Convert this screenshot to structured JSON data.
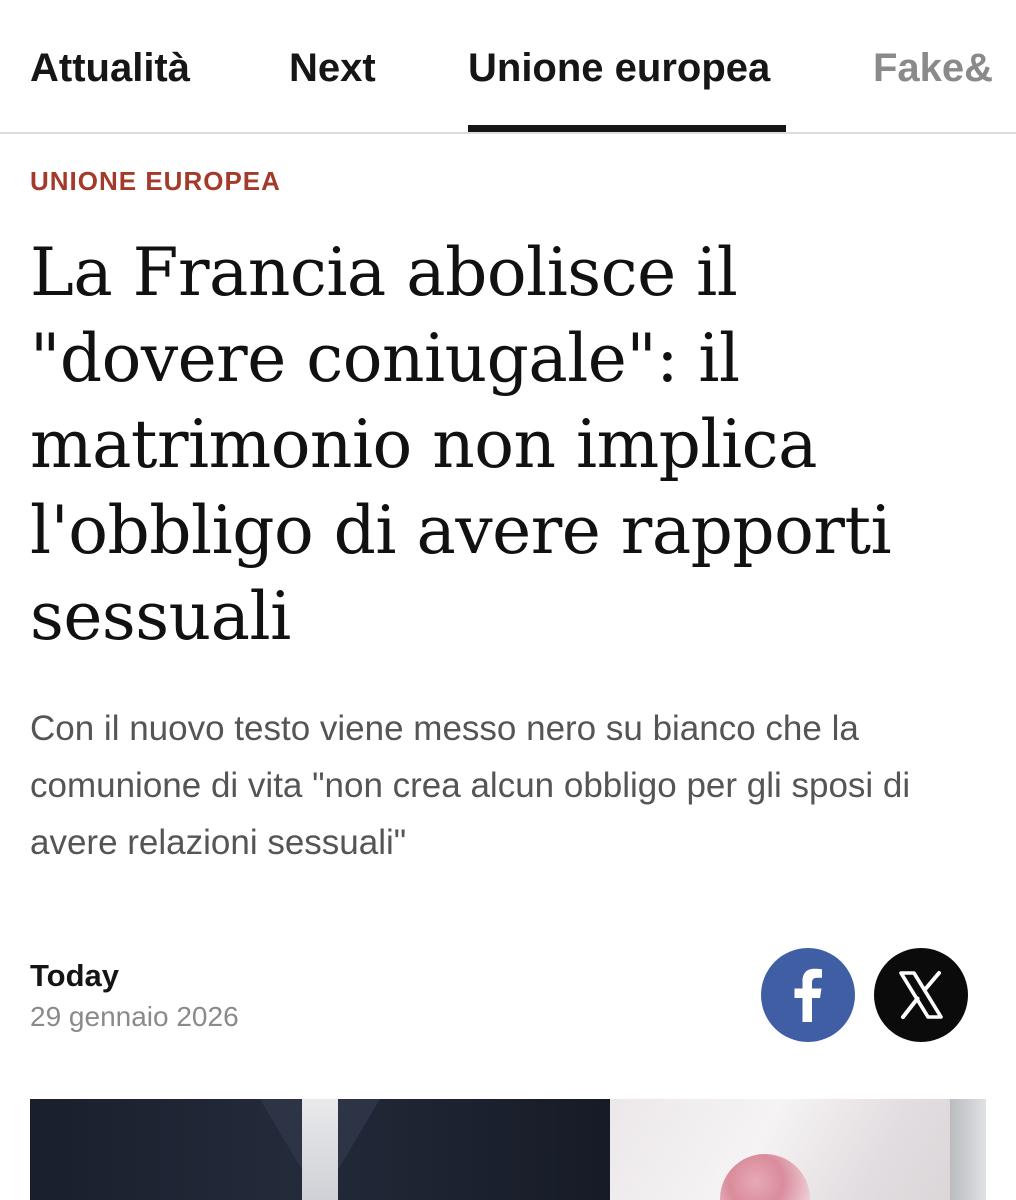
{
  "nav": {
    "tabs": [
      {
        "label": "Attualità"
      },
      {
        "label": "Next"
      },
      {
        "label": "Unione europea",
        "active": true
      },
      {
        "label": "Fake&"
      }
    ]
  },
  "article": {
    "kicker": "UNIONE EUROPEA",
    "headline": "La Francia abolisce il \"dovere coniugale\": il matrimonio non implica l'obbligo di avere rapporti sessuali",
    "subheadline": "Con il nuovo testo viene messo nero su bianco che la comunione di vita \"non crea alcun obbligo per gli sposi di avere relazioni sessuali\"",
    "source": "Today",
    "date": "29 gennaio 2026"
  },
  "share": {
    "facebook_icon": "facebook-icon",
    "x_icon": "x-icon"
  },
  "colors": {
    "kicker": "#a33a2a",
    "facebook": "#3f5ea4",
    "x": "#0b0b0b",
    "inactive_tab": "#8a8a8a"
  }
}
